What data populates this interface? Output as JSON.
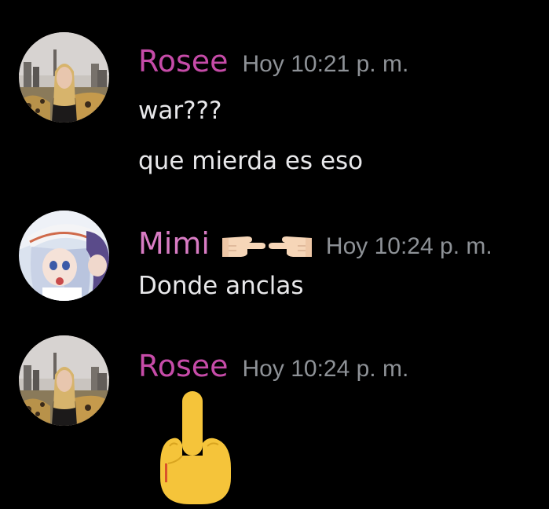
{
  "colors": {
    "background": "#000000",
    "username_rosee": "#c64ba8",
    "username_mimi": "#d97cc4",
    "timestamp": "#8e9297",
    "text": "#e8e8ea"
  },
  "messages": [
    {
      "username": "Rosee",
      "timestamp": "Hoy 10:21 p. m.",
      "lines": [
        "war???",
        "que mierda es eso"
      ]
    },
    {
      "username": "Mimi",
      "username_emojis": [
        "pointing-right-hand-icon",
        "pointing-left-hand-icon"
      ],
      "timestamp": "Hoy 10:24 p. m.",
      "lines": [
        "Donde anclas"
      ]
    },
    {
      "username": "Rosee",
      "timestamp": "Hoy 10:24 p. m.",
      "attachment": "middle-finger-emoji-icon"
    }
  ]
}
